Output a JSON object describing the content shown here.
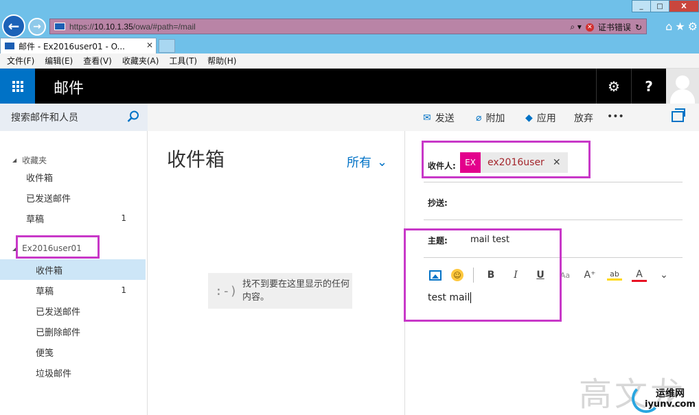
{
  "browser": {
    "url_prefix": "https://",
    "url_host": "10.10.1.35",
    "url_path": "/owa/#path=/mail",
    "cert_error": "证书错误",
    "tab_title": "邮件 - Ex2016user01 - O...",
    "window_controls": [
      "_",
      "□",
      "X"
    ],
    "menu": [
      "文件(F)",
      "编辑(E)",
      "查看(V)",
      "收藏夹(A)",
      "工具(T)",
      "帮助(H)"
    ]
  },
  "owa": {
    "app_title": "邮件",
    "settings_icon": "gear-icon",
    "help_label": "?"
  },
  "commands": {
    "search_placeholder": "搜索邮件和人员",
    "send": "发送",
    "attach": "附加",
    "apps": "应用",
    "discard": "放弃",
    "more": "•••"
  },
  "folders": {
    "favorites_label": "收藏夹",
    "favorites": [
      {
        "label": "收件箱",
        "count": ""
      },
      {
        "label": "已发送邮件",
        "count": ""
      },
      {
        "label": "草稿",
        "count": "1"
      }
    ],
    "account_label": "Ex2016user01",
    "account_folders": [
      {
        "label": "收件箱",
        "count": "",
        "selected": true
      },
      {
        "label": "草稿",
        "count": "1"
      },
      {
        "label": "已发送邮件",
        "count": ""
      },
      {
        "label": "已删除邮件",
        "count": ""
      },
      {
        "label": "便笺",
        "count": ""
      },
      {
        "label": "垃圾邮件",
        "count": ""
      }
    ]
  },
  "message_list": {
    "title": "收件箱",
    "filter": "所有",
    "empty_face": ":-)",
    "empty_text": "找不到要在这里显示的任何内容。"
  },
  "compose": {
    "to_label": "收件人:",
    "recipient_initials": "EX",
    "recipient_name": "ex2016user",
    "cc_label": "抄送:",
    "subject_label": "主题:",
    "subject_value": "mail test",
    "body": "test mail",
    "format": {
      "bold": "B",
      "italic": "I",
      "underline": "U",
      "font_size": "Aa",
      "grow": "A⁺",
      "highlight": "ab",
      "font_color": "A"
    }
  },
  "watermark": {
    "chars": "高文龙",
    "site_cn": "运维网",
    "site_en": "iyunv.com"
  },
  "colors": {
    "ie_chrome": "#6fc0e9",
    "owa_brand": "#0072c6",
    "annotation": "#c838c8",
    "recipient_badge": "#e3008c"
  }
}
